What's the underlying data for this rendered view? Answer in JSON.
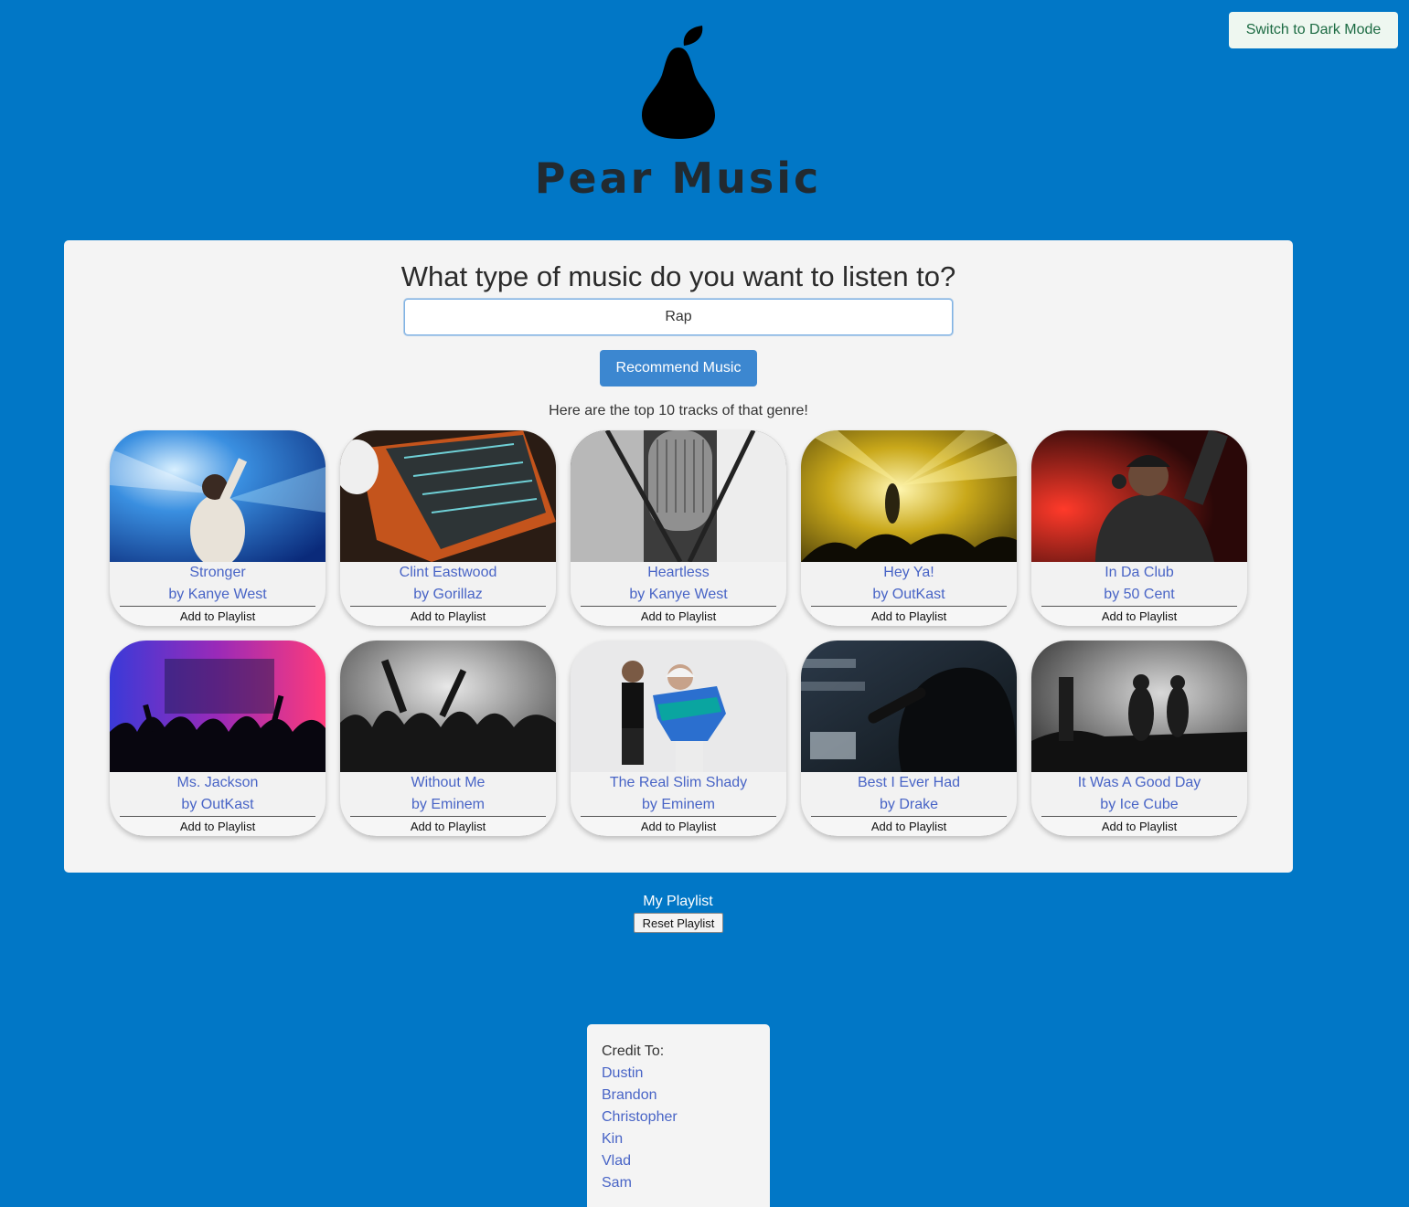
{
  "header": {
    "dark_mode_label": "Switch to Dark Mode",
    "brand": "Pear Music"
  },
  "search": {
    "question": "What type of music do you want to listen to?",
    "value": "Rap",
    "recommend_label": "Recommend Music",
    "results_caption": "Here are the top 10 tracks of that genre!"
  },
  "tracks": [
    {
      "title": "Stronger",
      "artist": "by Kanye West",
      "add_label": "Add to Playlist"
    },
    {
      "title": "Clint Eastwood",
      "artist": "by Gorillaz",
      "add_label": "Add to Playlist"
    },
    {
      "title": "Heartless",
      "artist": "by Kanye West",
      "add_label": "Add to Playlist"
    },
    {
      "title": "Hey Ya!",
      "artist": "by OutKast",
      "add_label": "Add to Playlist"
    },
    {
      "title": "In Da Club",
      "artist": "by 50 Cent",
      "add_label": "Add to Playlist"
    },
    {
      "title": "Ms. Jackson",
      "artist": "by OutKast",
      "add_label": "Add to Playlist"
    },
    {
      "title": "Without Me",
      "artist": "by Eminem",
      "add_label": "Add to Playlist"
    },
    {
      "title": "The Real Slim Shady",
      "artist": "by Eminem",
      "add_label": "Add to Playlist"
    },
    {
      "title": "Best I Ever Had",
      "artist": "by Drake",
      "add_label": "Add to Playlist"
    },
    {
      "title": "It Was A Good Day",
      "artist": "by Ice Cube",
      "add_label": "Add to Playlist"
    }
  ],
  "playlist": {
    "title": "My Playlist",
    "reset_label": "Reset Playlist"
  },
  "credits": {
    "label": "Credit To:",
    "names": [
      "Dustin",
      "Brandon",
      "Christopher",
      "Kin",
      "Vlad",
      "Sam"
    ]
  },
  "colors": {
    "background": "#0177c6",
    "panel": "#f4f4f4",
    "link": "#4864c6",
    "button": "#3c87d0"
  }
}
